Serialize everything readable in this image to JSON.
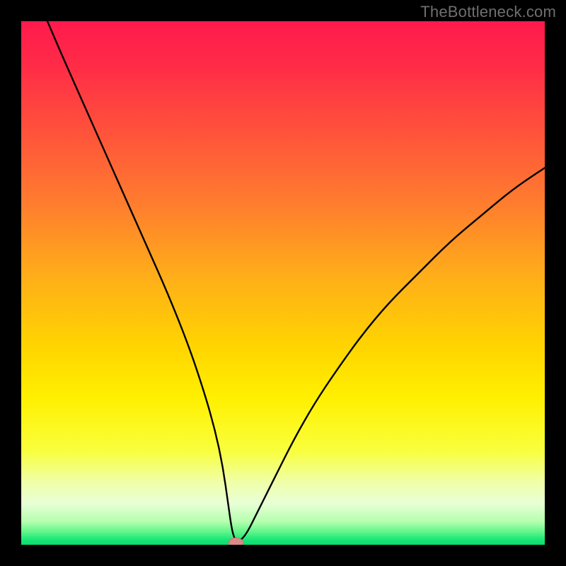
{
  "watermark": "TheBottleneck.com",
  "colors": {
    "frame": "#000000",
    "curve": "#000000",
    "marker_fill": "#d98b86",
    "marker_stroke": "#c07871",
    "gradient_stops": [
      {
        "offset": 0.0,
        "color": "#ff1a4d"
      },
      {
        "offset": 0.08,
        "color": "#ff2a47"
      },
      {
        "offset": 0.2,
        "color": "#ff4f3c"
      },
      {
        "offset": 0.35,
        "color": "#ff7d2e"
      },
      {
        "offset": 0.5,
        "color": "#ffb217"
      },
      {
        "offset": 0.62,
        "color": "#ffd400"
      },
      {
        "offset": 0.72,
        "color": "#fff000"
      },
      {
        "offset": 0.82,
        "color": "#f9ff3d"
      },
      {
        "offset": 0.88,
        "color": "#f0ffa8"
      },
      {
        "offset": 0.92,
        "color": "#e8ffd6"
      },
      {
        "offset": 0.955,
        "color": "#b7ffb0"
      },
      {
        "offset": 0.975,
        "color": "#62f58a"
      },
      {
        "offset": 0.99,
        "color": "#18e877"
      },
      {
        "offset": 1.0,
        "color": "#0bdc6e"
      }
    ]
  },
  "chart_data": {
    "type": "line",
    "title": "",
    "xlabel": "",
    "ylabel": "",
    "xlim": [
      0,
      100
    ],
    "ylim": [
      0,
      100
    ],
    "grid": false,
    "legend": false,
    "series": [
      {
        "name": "bottleneck-curve",
        "x": [
          5,
          8,
          12,
          16,
          20,
          24,
          28,
          32,
          35,
          37,
          38.5,
          39.5,
          40.2,
          40.8,
          41.5,
          43,
          45,
          48,
          52,
          56,
          60,
          65,
          70,
          76,
          82,
          88,
          94,
          100
        ],
        "y": [
          100,
          93,
          84,
          75,
          66,
          57,
          48,
          38,
          29,
          22,
          15,
          8,
          3,
          1,
          0.5,
          2,
          6,
          12,
          20,
          27,
          33,
          40,
          46,
          52,
          58,
          63,
          68,
          72
        ]
      }
    ],
    "marker": {
      "x": 41.0,
      "y": 0.4,
      "rx": 1.4,
      "ry": 0.9
    }
  }
}
